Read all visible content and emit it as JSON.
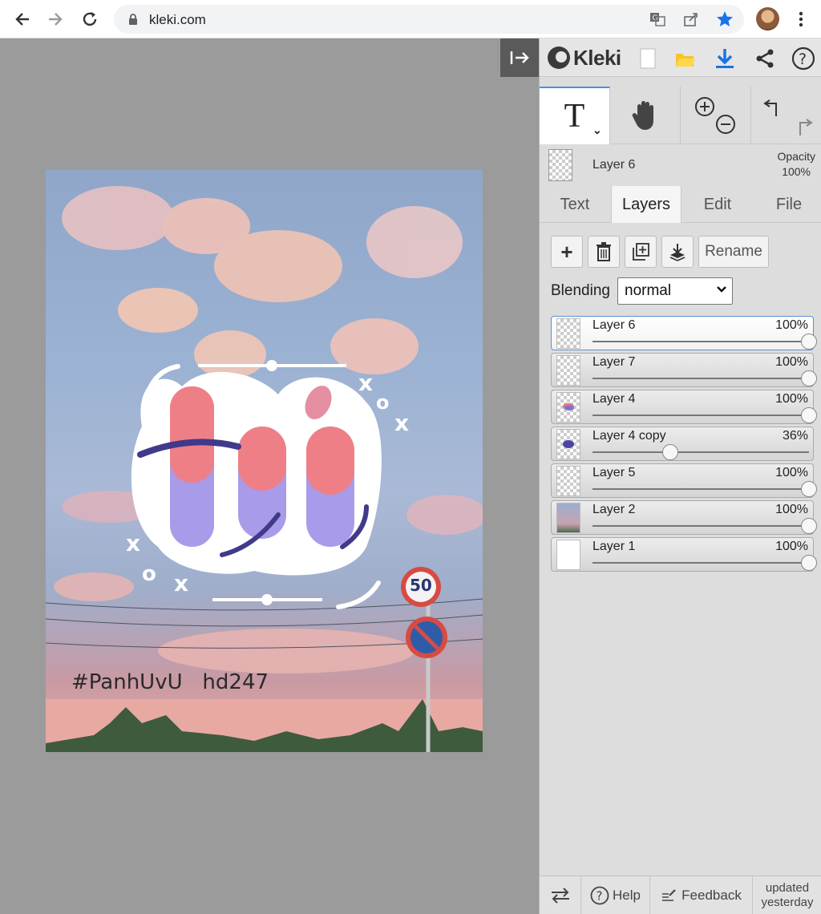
{
  "browser": {
    "url": "kleki.com",
    "back_icon": "back-arrow-icon",
    "forward_icon": "forward-arrow-icon",
    "reload_icon": "reload-icon"
  },
  "canvas": {
    "watermark_text": "#PanhUvU   hd247",
    "sign_speed": "50",
    "sticker_text": "ti"
  },
  "app": {
    "brand": "Kleki",
    "collapse_icon": "collapse-panel-icon"
  },
  "tools": {
    "text_tool_label": "T",
    "hand_icon": "hand-icon",
    "zoom_in_icon": "zoom-in-icon",
    "zoom_out_icon": "zoom-out-icon",
    "undo_icon": "undo-icon",
    "redo_icon": "redo-icon"
  },
  "current_layer": {
    "name": "Layer 6",
    "opacity_label": "Opacity",
    "opacity_value": "100%"
  },
  "tabs": [
    {
      "label": "Text"
    },
    {
      "label": "Layers"
    },
    {
      "label": "Edit"
    },
    {
      "label": "File"
    }
  ],
  "layer_actions": {
    "add_symbol": "+",
    "rename_label": "Rename"
  },
  "blending": {
    "label": "Blending",
    "value": "normal"
  },
  "layers": [
    {
      "name": "Layer 6",
      "opacity": "100%",
      "opacity_fraction": 1.0,
      "selected": true
    },
    {
      "name": "Layer 7",
      "opacity": "100%",
      "opacity_fraction": 1.0,
      "selected": false
    },
    {
      "name": "Layer 4",
      "opacity": "100%",
      "opacity_fraction": 1.0,
      "selected": false
    },
    {
      "name": "Layer 4 copy",
      "opacity": "36%",
      "opacity_fraction": 0.36,
      "selected": false
    },
    {
      "name": "Layer 5",
      "opacity": "100%",
      "opacity_fraction": 1.0,
      "selected": false
    },
    {
      "name": "Layer 2",
      "opacity": "100%",
      "opacity_fraction": 1.0,
      "selected": false
    },
    {
      "name": "Layer 1",
      "opacity": "100%",
      "opacity_fraction": 1.0,
      "selected": false
    }
  ],
  "footer": {
    "help_label": "Help",
    "feedback_label": "Feedback",
    "updated_line1": "updated",
    "updated_line2": "yesterday"
  },
  "colors": {
    "accent": "#4d8ee6",
    "panel_bg": "#dddddd",
    "canvas_bg": "#9b9b9b"
  }
}
